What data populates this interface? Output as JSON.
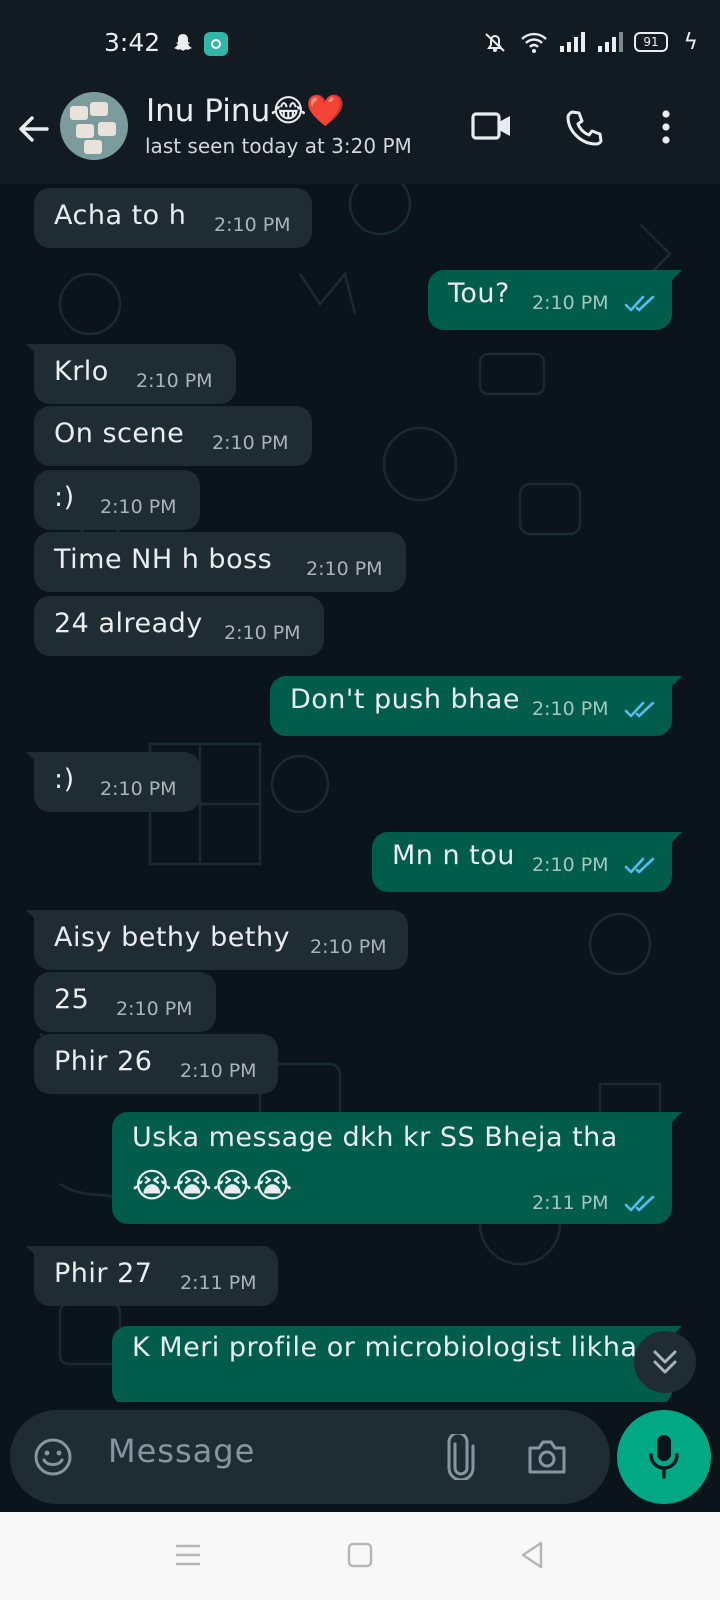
{
  "status_bar": {
    "time": "3:42",
    "battery": "91"
  },
  "header": {
    "contact_name": "Inu Pinu😂❤️",
    "last_seen": "last seen today at 3:20 PM"
  },
  "messages": [
    {
      "dir": "in",
      "text": "Acha to h",
      "time": "2:10 PM"
    },
    {
      "dir": "out",
      "text": "Tou?",
      "time": "2:10 PM"
    },
    {
      "dir": "in",
      "text": "Krlo",
      "time": "2:10 PM"
    },
    {
      "dir": "in",
      "text": "On scene",
      "time": "2:10 PM"
    },
    {
      "dir": "in",
      "text": ":)",
      "time": "2:10 PM"
    },
    {
      "dir": "in",
      "text": "Time NH h boss",
      "time": "2:10 PM"
    },
    {
      "dir": "in",
      "text": "24 already",
      "time": "2:10 PM"
    },
    {
      "dir": "out",
      "text": "Don't push bhae",
      "time": "2:10 PM"
    },
    {
      "dir": "in",
      "text": ":)",
      "time": "2:10 PM"
    },
    {
      "dir": "out",
      "text": "Mn n tou",
      "time": "2:10 PM"
    },
    {
      "dir": "in",
      "text": "Aisy bethy bethy",
      "time": "2:10 PM"
    },
    {
      "dir": "in",
      "text": "25",
      "time": "2:10 PM"
    },
    {
      "dir": "in",
      "text": "Phir 26",
      "time": "2:10 PM"
    },
    {
      "dir": "out",
      "text": "Uska message dkh kr SS Bheja tha",
      "text2": "😭😭😭😭",
      "time": "2:11 PM"
    },
    {
      "dir": "in",
      "text": "Phir 27",
      "time": "2:11 PM"
    },
    {
      "dir": "out",
      "text": "K Meri profile or microbiologist likha",
      "time": ""
    }
  ],
  "composer": {
    "placeholder": "Message"
  },
  "colors": {
    "incoming_bubble": "#202c33",
    "outgoing_bubble": "#005c4b",
    "accent": "#00a884",
    "read_ticks": "#53bdeb"
  }
}
